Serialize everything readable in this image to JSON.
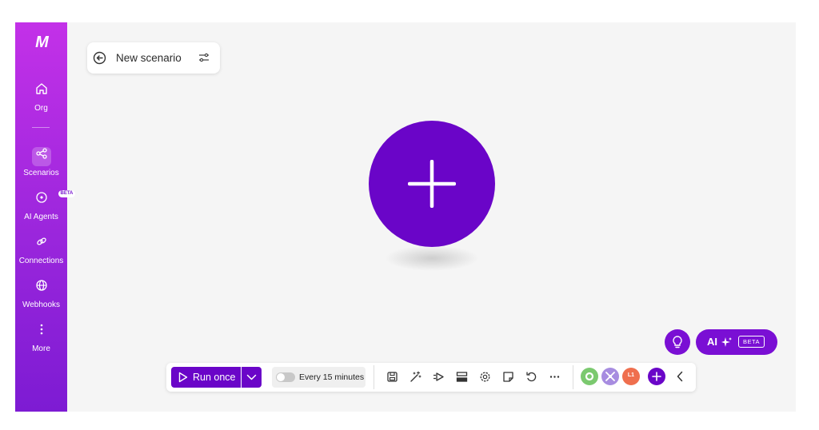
{
  "sidebar": {
    "logo": "M",
    "items": [
      {
        "label": "Org",
        "icon": "home-icon"
      },
      {
        "label": "Scenarios",
        "icon": "share-nodes-icon",
        "active": true
      },
      {
        "label": "AI Agents",
        "icon": "ai-agent-icon",
        "badge": "BETA"
      },
      {
        "label": "Connections",
        "icon": "link-icon"
      },
      {
        "label": "Webhooks",
        "icon": "globe-icon"
      },
      {
        "label": "More",
        "icon": "more-vertical-icon"
      }
    ]
  },
  "header": {
    "back_icon": "back-arrow-icon",
    "title": "New scenario",
    "settings_icon": "sliders-icon"
  },
  "canvas": {
    "add_module_icon": "plus-icon"
  },
  "assist": {
    "bulb_icon": "lightbulb-icon",
    "ai_label": "AI",
    "ai_badge": "BETA"
  },
  "toolbar": {
    "run_label": "Run once",
    "schedule_label": "Every 15 minutes",
    "schedule_enabled": false,
    "tools": [
      "save-icon",
      "magic-wand-icon",
      "flow-icon",
      "routing-icon",
      "settings-icon",
      "notes-icon",
      "undo-icon",
      "more-horizontal-icon"
    ],
    "app_badges": [
      "L1"
    ]
  },
  "colors": {
    "brand_purple": "#6a05c8",
    "sidebar_top": "#c331e8",
    "sidebar_bottom": "#7d1bd3",
    "canvas_bg": "#f5f5f5"
  }
}
